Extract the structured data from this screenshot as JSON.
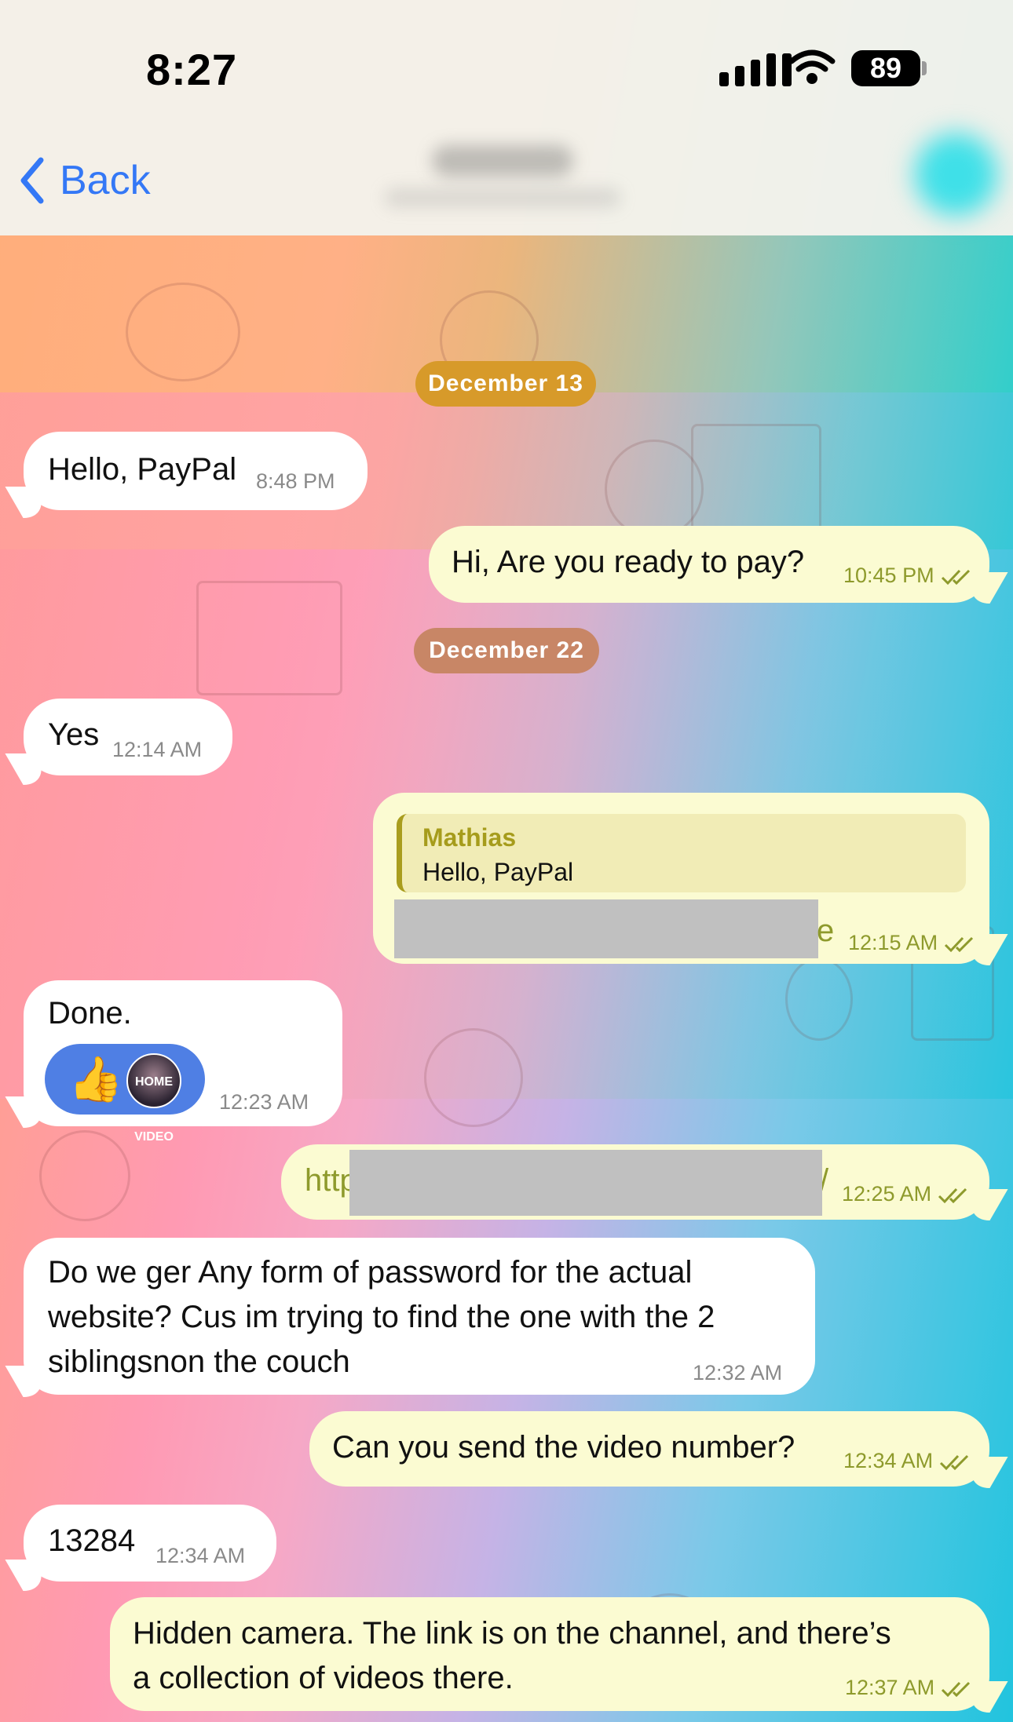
{
  "status_bar": {
    "time": "8:27",
    "battery": "89"
  },
  "nav": {
    "back_label": "Back"
  },
  "date_chips": [
    "December 13",
    "December 22"
  ],
  "messages": [
    {
      "dir": "in",
      "text": "Hello, PayPal",
      "time": "8:48 PM"
    },
    {
      "dir": "out",
      "text": "Hi, Are you ready to pay?",
      "time": "10:45 PM"
    },
    {
      "dir": "in",
      "text": "Yes",
      "time": "12:14 AM"
    },
    {
      "dir": "out",
      "reply_to_name": "Mathias",
      "reply_to_text": "Hello, PayPal",
      "visible_suffix": "e",
      "time": "12:15 AM"
    },
    {
      "dir": "in",
      "text": "Done.",
      "time": "12:23 AM",
      "reactions": {
        "emoji": "👍",
        "avatar_text": "HOME VIDEO"
      }
    },
    {
      "dir": "out",
      "visible_prefix": "http",
      "visible_suffix": "/",
      "time": "12:25 AM"
    },
    {
      "dir": "in",
      "lines": [
        "Do we ger Any form of password for the actual",
        "website? Cus im trying to find the one with the 2",
        "siblingsnon the couch"
      ],
      "time": "12:32 AM"
    },
    {
      "dir": "out",
      "text": "Can you send the video number?",
      "time": "12:34 AM"
    },
    {
      "dir": "in",
      "text": "13284",
      "time": "12:34 AM"
    },
    {
      "dir": "out",
      "lines": [
        "Hidden camera. The link is on the channel, and there’s",
        "a collection of videos there."
      ],
      "time": "12:37 AM"
    }
  ],
  "colors": {
    "accent": "#3478f6",
    "outgoing_bubble": "#fbfbd2",
    "incoming_bubble": "#ffffff",
    "chip_dec13": "#d79a2a",
    "chip_dec22": "#c88666",
    "reply_accent": "#a99d1e",
    "reaction_bg": "#4f7fe4"
  },
  "icons": [
    "chevron-left-icon",
    "signal-icon",
    "wifi-icon",
    "battery-icon",
    "double-check-icon",
    "thumbs-up-icon"
  ]
}
